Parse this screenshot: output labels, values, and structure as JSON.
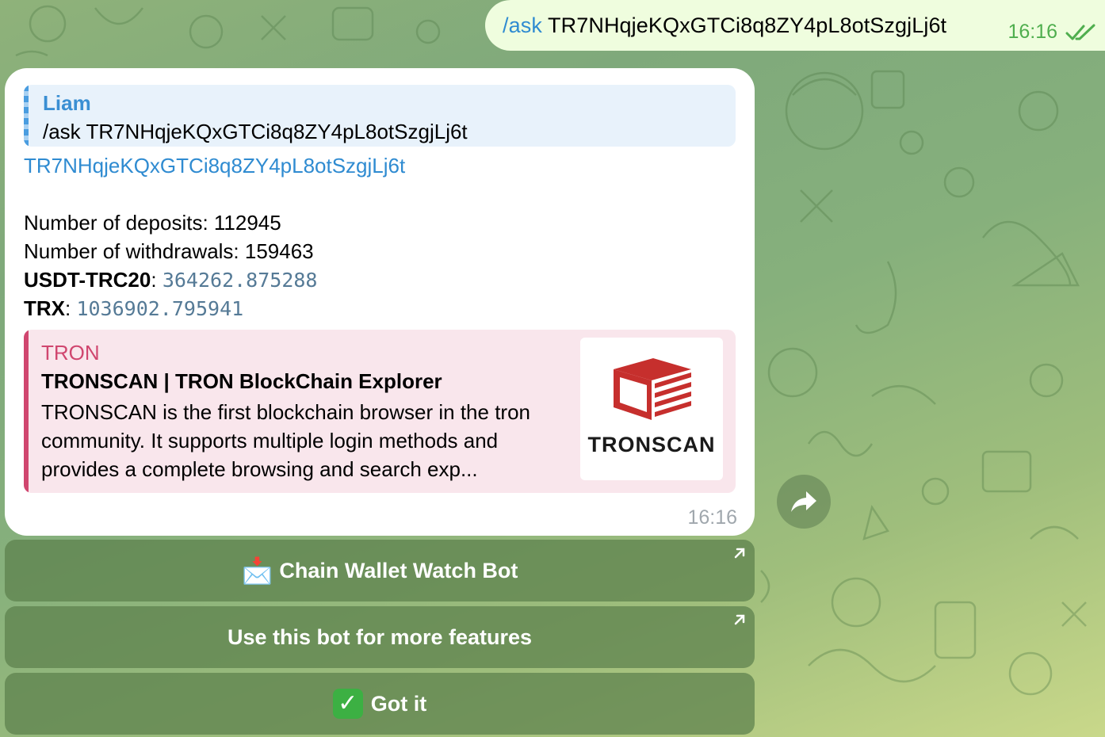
{
  "outgoing": {
    "command": "/ask",
    "text": " TR7NHqjeKQxGTCi8q8ZY4pL8otSzgjLj6t",
    "time": "16:16"
  },
  "incoming": {
    "reply_name": "Liam",
    "reply_text": "/ask TR7NHqjeKQxGTCi8q8ZY4pL8otSzgjLj6t",
    "address_link": "TR7NHqjeKQxGTCi8q8ZY4pL8otSzgjLj6t",
    "deposits_label": "Number of deposits: 112945",
    "withdrawals_label": "Number of withdrawals: 159463",
    "usdt_label": "USDT-TRC20",
    "usdt_value": "364262.875288",
    "trx_label": "TRX",
    "trx_value": "1036902.795941",
    "time": "16:16",
    "preview": {
      "site": "TRON",
      "title": "TRONSCAN | TRON BlockChain Explorer",
      "description": "TRONSCAN is the first blockchain browser in the tron community. It supports multiple login methods and provides a complete browsing and search exp...",
      "thumb_label": "TRONSCAN"
    }
  },
  "keyboard": {
    "button1": "Chain Wallet Watch Bot",
    "button1_emoji": "📩",
    "button2": "Use this bot for more features",
    "button3": "Got it",
    "button3_emoji": "✓"
  },
  "colors": {
    "outgoing_bg": "#effdde",
    "link": "#2f8bd1",
    "preview_accent": "#d0466f",
    "tronscan_red": "#c62f2d"
  },
  "icons": [
    "double-check-icon",
    "share-icon",
    "external-link-icon",
    "envelope-emoji",
    "check-emoji",
    "tronscan-logo"
  ]
}
